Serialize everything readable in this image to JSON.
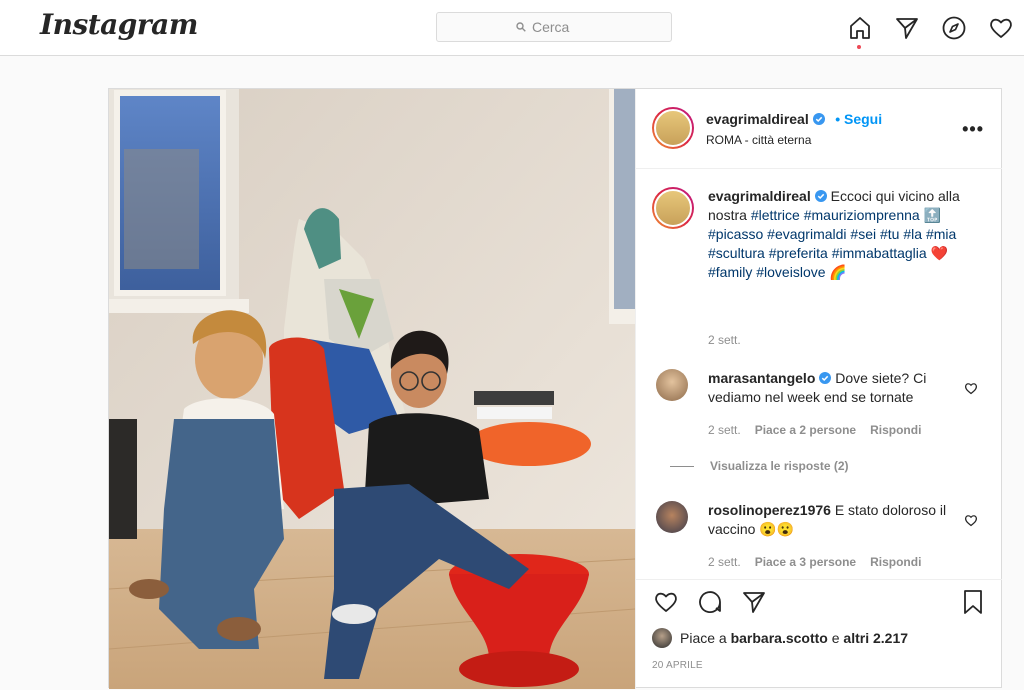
{
  "topbar": {
    "logo": "Instagram",
    "search_placeholder": "Cerca",
    "nav_icons": [
      "home-icon",
      "direct-icon",
      "explore-icon",
      "activity-icon"
    ]
  },
  "post": {
    "author": "evagrimaldireal",
    "follow_label": "• Segui",
    "location": "ROMA - città eterna",
    "more_label": "•••",
    "caption": {
      "username": "evagrimaldireal",
      "text_before": "Eccoci qui vicino alla nostra",
      "tags_line1": [
        "#lettrice",
        "#mauriziomprenna"
      ],
      "emoji_top": "🔝",
      "tags_line2": [
        "#picasso",
        "#evagrimaldi",
        "#sei",
        "#tu",
        "#la",
        "#mia",
        "#scultura",
        "#preferita",
        "#immabattaglia"
      ],
      "emoji_heart": "❤️",
      "tags_line3": [
        "#family",
        "#loveislove"
      ],
      "emoji_rainbow": "🌈",
      "time": "2 sett."
    },
    "comments": [
      {
        "username": "marasantangelo",
        "verified": true,
        "text": "Dove siete? Ci vediamo nel week end se tornate",
        "time": "2 sett.",
        "likes": "Piace a 2 persone",
        "reply": "Rispondi",
        "view_replies": "Visualizza le risposte (2)"
      },
      {
        "username": "rosolinoperez1976",
        "verified": false,
        "text": "E stato doloroso il vaccino 😮😮",
        "time": "2 sett.",
        "likes": "Piace a 3 persone",
        "reply": "Rispondi"
      }
    ],
    "likes_prefix": "Piace a ",
    "likes_user": "barbara.scotto",
    "likes_mid": " e ",
    "likes_others": "altri 2.217",
    "date": "20 APRILE"
  },
  "colors": {
    "accent": "#0095f6",
    "hashtag": "#00376b",
    "muted": "#8e8e8e",
    "border": "#dbdbdb"
  }
}
